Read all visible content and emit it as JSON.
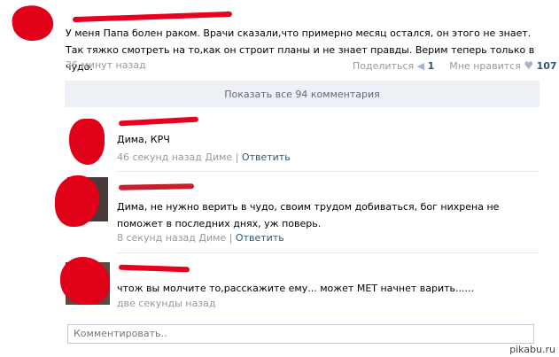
{
  "post": {
    "text": "У меня Папа болен раком. Врачи сказали,что примерно месяц остался, он этого не знает. Так тяжко смотреть на то,как он строит планы и не знает правды. Верим теперь только в чудо.",
    "time": "36 минут назад",
    "share_label": "Поделиться",
    "share_count": "1",
    "like_label": "Мне нравится",
    "like_count": "107"
  },
  "show_all_label": "Показать все 94 комментария",
  "comments": [
    {
      "text": "Дима, КРЧ",
      "time": "46 секунд назад Диме",
      "separator": "|",
      "reply": "Ответить"
    },
    {
      "text": "Дима, не нужно верить в чудо, своим трудом добиваться, бог нихрена не поможет в последних днях, уж поверь.",
      "time": "8 секунд назад Диме",
      "separator": "|",
      "reply": "Ответить"
    },
    {
      "text": "чтож вы молчите то,расскажите ему... может МЕТ начнет варить......",
      "time": "две секунды назад"
    }
  ],
  "comment_input": {
    "placeholder": "Комментировать.."
  },
  "watermark": "pikabu.ru",
  "colors": {
    "link": "#2b587a",
    "meta": "#999999",
    "scribble": "#e8001e",
    "show_all_bg": "#edf1f5"
  },
  "icons": [
    "megaphone-icon",
    "heart-icon"
  ]
}
